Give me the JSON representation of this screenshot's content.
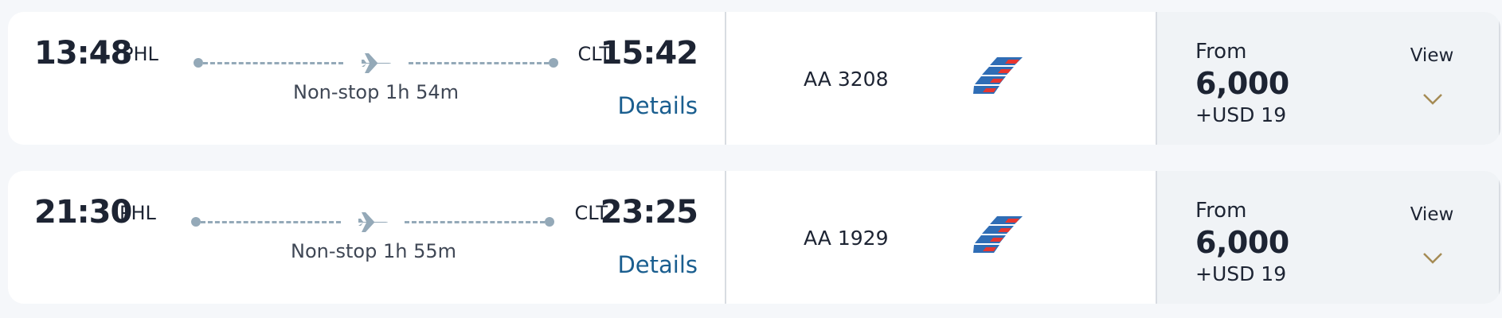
{
  "flights": [
    {
      "departure": {
        "time": "13:48",
        "airport": "PHL"
      },
      "arrival": {
        "time": "15:42",
        "airport": "CLT"
      },
      "duration": "Non-stop 1h 54m",
      "details_label": "Details",
      "flight_number": "AA 3208",
      "fare": {
        "from_label": "From",
        "miles": "6,000",
        "cash": "+USD 19",
        "view_label": "View"
      }
    },
    {
      "departure": {
        "time": "21:30",
        "airport": "PHL"
      },
      "arrival": {
        "time": "23:25",
        "airport": "CLT"
      },
      "duration": "Non-stop 1h 55m",
      "details_label": "Details",
      "flight_number": "AA 1929",
      "fare": {
        "from_label": "From",
        "miles": "6,000",
        "cash": "+USD 19",
        "view_label": "View"
      }
    }
  ],
  "icons": {
    "plane": "plane-icon",
    "airline_tail": "american-airlines-tail-logo",
    "expand": "chevron-down-icon"
  },
  "colors": {
    "link": "#1a5e8f",
    "route_line": "#94a9b8",
    "chevron": "#a58b55",
    "tail_blue": "#2f6db5",
    "tail_red": "#e8352f",
    "fare_bg": "#f0f3f6"
  }
}
